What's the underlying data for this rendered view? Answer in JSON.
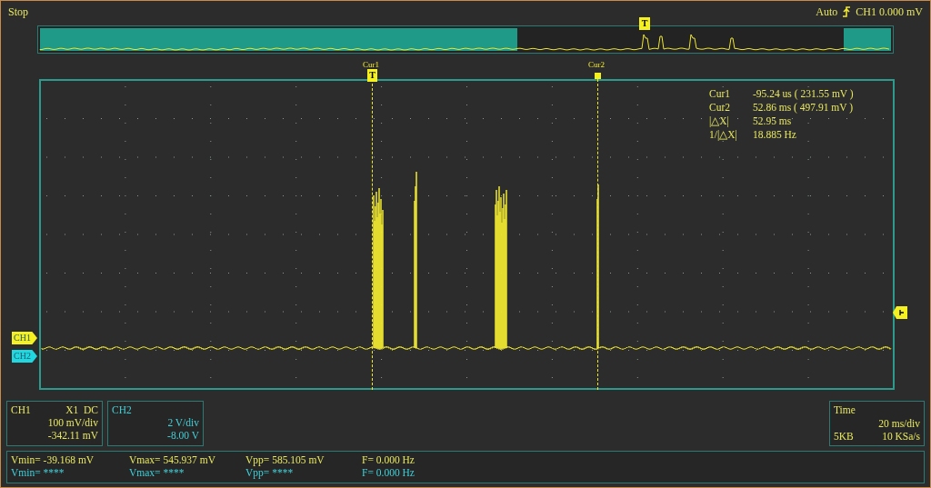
{
  "status_bar": {
    "run_state": "Stop",
    "trigger_mode": "Auto",
    "trigger_readout": "CH1 0.000 mV"
  },
  "overview": {
    "trigger_marker": "T"
  },
  "cursors": [
    {
      "label": "Cur1",
      "marker": "T"
    },
    {
      "label": "Cur2"
    }
  ],
  "cursor_readout": [
    {
      "label": "Cur1",
      "value": "-95.24 us ( 231.55 mV )"
    },
    {
      "label": "Cur2",
      "value": "52.86 ms ( 497.91 mV )"
    },
    {
      "label": "|△X|",
      "value": "52.95 ms"
    },
    {
      "label": "1/|△X|",
      "value": "18.885 Hz"
    }
  ],
  "channel_markers": [
    {
      "label": "CH1",
      "color": "#f5f020"
    },
    {
      "label": "CH2",
      "color": "#20d8e0"
    }
  ],
  "channels": [
    {
      "name": "CH1",
      "probe": "X1  DC",
      "scale": "100 mV/div",
      "offset": "-342.11 mV",
      "color": "#e8e860"
    },
    {
      "name": "CH2",
      "scale": "2 V/div",
      "offset": "-8.00 V",
      "color": "#40d0d8"
    }
  ],
  "timebase": {
    "title": "Time",
    "scale": "20 ms/div",
    "memory": "5KB",
    "sample_rate": "10 KSa/s"
  },
  "measurements": [
    {
      "color": "#e8e860",
      "values": [
        "Vmin= -39.168 mV",
        "Vmax= 545.937 mV",
        "Vpp= 585.105 mV",
        "F= 0.000 Hz"
      ]
    },
    {
      "color": "#40d0d8",
      "values": [
        "Vmin= ****",
        "Vmax= ****",
        "Vpp= ****",
        "F= 0.000 Hz"
      ]
    }
  ]
}
